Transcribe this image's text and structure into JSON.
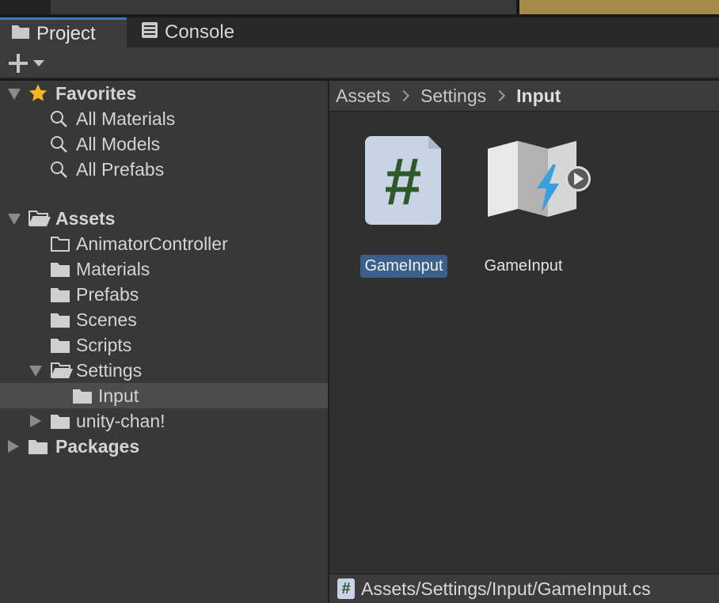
{
  "tabs": [
    {
      "label": "Project",
      "icon": "folder-icon",
      "active": true
    },
    {
      "label": "Console",
      "icon": "console-icon",
      "active": false
    }
  ],
  "toolbar": {
    "add_icon": "plus-icon",
    "menu_icon": "caret-down-icon"
  },
  "tree": {
    "favorites": {
      "label": "Favorites",
      "icon": "star-icon",
      "items": [
        "All Materials",
        "All Models",
        "All Prefabs"
      ]
    },
    "assets": {
      "label": "Assets",
      "children": [
        {
          "label": "AnimatorController",
          "state": "empty"
        },
        {
          "label": "Materials",
          "state": "folder"
        },
        {
          "label": "Prefabs",
          "state": "folder"
        },
        {
          "label": "Scenes",
          "state": "folder"
        },
        {
          "label": "Scripts",
          "state": "folder"
        },
        {
          "label": "Settings",
          "state": "expanded"
        },
        {
          "label": "Input",
          "state": "selected"
        },
        {
          "label": "unity-chan!",
          "state": "collapsed"
        }
      ]
    },
    "packages": {
      "label": "Packages"
    }
  },
  "breadcrumb": [
    "Assets",
    "Settings",
    "Input"
  ],
  "assets_grid": [
    {
      "label": "GameInput",
      "type": "csharp-script",
      "selected": true,
      "glyph": "#"
    },
    {
      "label": "GameInput",
      "type": "input-actions",
      "selected": false
    }
  ],
  "status": {
    "path": "Assets/Settings/Input/GameInput.cs",
    "icon_glyph": "#"
  },
  "colors": {
    "accent": "#3a79bb",
    "selection": "#3d5f8b",
    "star": "#f4b52a",
    "script_hash": "#2e5a2a",
    "lightning": "#3aa0dd"
  }
}
